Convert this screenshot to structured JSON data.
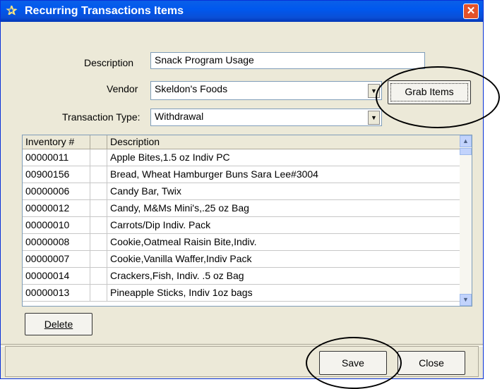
{
  "window": {
    "title": "Recurring Transactions Items",
    "title_icon": "star-icon",
    "close_glyph": "✕"
  },
  "form": {
    "description_label": "Description",
    "description_value": "Snack Program Usage",
    "vendor_label": "Vendor",
    "vendor_value": "Skeldon's Foods",
    "transaction_type_label": "Transaction Type:",
    "transaction_type_value": "Withdrawal",
    "grab_items_label": "Grab Items"
  },
  "grid": {
    "columns": [
      "Inventory #",
      "",
      "Description"
    ],
    "rows": [
      {
        "inv": "00000011",
        "desc": "Apple Bites,1.5 oz Indiv PC"
      },
      {
        "inv": "00900156",
        "desc": "Bread, Wheat Hamburger Buns Sara Lee#3004"
      },
      {
        "inv": "00000006",
        "desc": "Candy Bar, Twix"
      },
      {
        "inv": "00000012",
        "desc": "Candy, M&Ms Mini's,.25 oz Bag"
      },
      {
        "inv": "00000010",
        "desc": "Carrots/Dip Indiv. Pack"
      },
      {
        "inv": "00000008",
        "desc": "Cookie,Oatmeal Raisin Bite,Indiv."
      },
      {
        "inv": "00000007",
        "desc": "Cookie,Vanilla Waffer,Indiv Pack"
      },
      {
        "inv": "00000014",
        "desc": "Crackers,Fish, Indiv. .5 oz Bag"
      },
      {
        "inv": "00000013",
        "desc": "Pineapple Sticks, Indiv 1oz bags"
      }
    ]
  },
  "buttons": {
    "delete_label": "Delete",
    "save_label": "Save",
    "close_label": "Close"
  },
  "colors": {
    "titlebar": "#0058ee",
    "dialog_bg": "#ece9d8",
    "close_button": "#e2522a"
  }
}
